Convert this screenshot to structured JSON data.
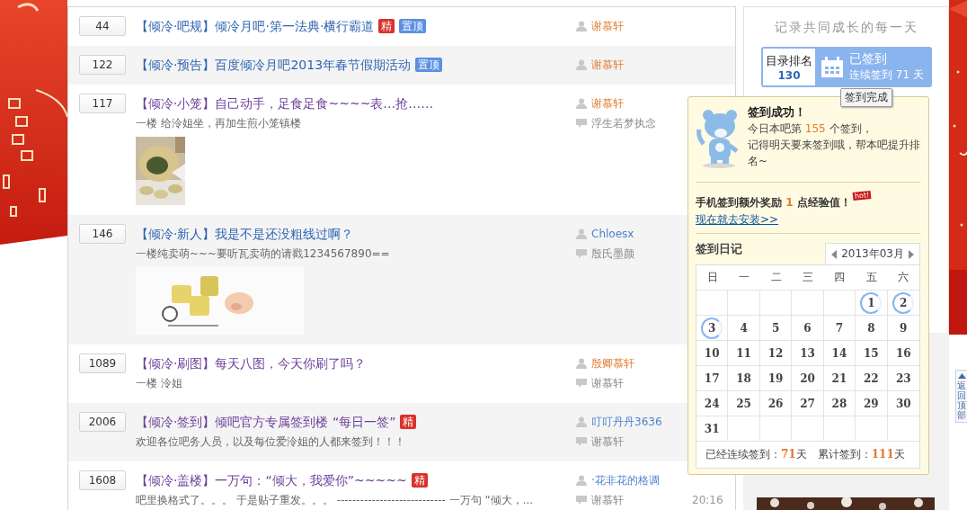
{
  "threads": [
    {
      "reply_count": "44",
      "title": "【倾冷·吧规】倾冷月吧·第一法典·横行霸道",
      "visited": false,
      "badges": [
        {
          "kind": "best",
          "text": "精"
        },
        {
          "kind": "top",
          "text": "置顶"
        }
      ],
      "author": {
        "name": "谢慕轩",
        "color": "#e07a30"
      }
    },
    {
      "reply_count": "122",
      "title": "【倾冷·预告】百度倾冷月吧2013年春节假期活动",
      "visited": false,
      "badges": [
        {
          "kind": "top",
          "text": "置顶"
        }
      ],
      "author": {
        "name": "谢慕轩",
        "color": "#e07a30"
      }
    },
    {
      "reply_count": "117",
      "title": "【倾冷·小笼】自己动手，足食足食~~~~表…抢……",
      "visited": true,
      "author": {
        "name": "谢慕轩",
        "color": "#e07a30"
      },
      "summary": "一楼  给泠姐坐，再加生煎小笼镇楼",
      "last_reply": "浮生若梦执念"
    },
    {
      "reply_count": "146",
      "title": "【倾冷·新人】我是不是还没粗线过啊？",
      "visited": false,
      "author": {
        "name": "Chloesx",
        "color": "#4f7fcf"
      },
      "summary": "一楼纯卖萌~~~要听瓦卖萌的请戳1234567890==",
      "last_reply": "殷氏墨颜"
    },
    {
      "reply_count": "1089",
      "title": "【倾冷·刷图】每天八图，今天你刷了吗？",
      "visited": true,
      "author": {
        "name": "殷卿慕轩",
        "color": "#e07a30"
      },
      "summary": "一楼  泠姐",
      "last_reply": "谢慕轩"
    },
    {
      "reply_count": "2006",
      "title": "【倾冷·签到】倾吧官方专属签到楼 “每日一签”",
      "visited": true,
      "badges": [
        {
          "kind": "best",
          "text": "精"
        }
      ],
      "author": {
        "name": "叮叮丹丹3636",
        "color": "#4f7fcf"
      },
      "summary": "欢迎各位吧务人员，以及每位爱泠姐的人都来签到！！！",
      "last_reply": "谢慕轩"
    },
    {
      "reply_count": "1608",
      "title": "【倾冷·盖楼】一万句：“倾大，我爱你”~~~~~",
      "visited": true,
      "badges": [
        {
          "kind": "best",
          "text": "精"
        }
      ],
      "author": {
        "name": "·花非花的格调",
        "color": "#4f7fcf"
      },
      "summary": "吧里换格式了。。。  于是贴子重发。。。  ---------------------------- 一万句 “倾大，...",
      "last_reply": "谢慕轩",
      "time": "20:16"
    }
  ],
  "sidebar": {
    "slogan": "记录共同成长的每一天",
    "rank_label": "目录排名",
    "rank": "130",
    "signed": true,
    "sign_status": "已签到",
    "streak": "连续签到 71 天",
    "tooltip": "签到完成"
  },
  "popup": {
    "title": "签到成功！",
    "message": [
      "今日本吧第 **155** 个签到，",
      "记得明天要来签到哦，帮本吧提升排名~"
    ],
    "reward": "手机签到额外奖励 **1** 点经验值！",
    "hot_badge": "hot!",
    "link": "现在就去安装>>",
    "diary_title": "签到日记",
    "month": "2013年03月",
    "weekdays": [
      "日",
      "一",
      "二",
      "三",
      "四",
      "五",
      "六"
    ],
    "weeks": [
      [
        {
          "kind": "blank"
        },
        {
          "kind": "blank"
        },
        {
          "kind": "blank"
        },
        {
          "kind": "blank"
        },
        {
          "kind": "blank"
        },
        {
          "kind": "day",
          "day": "1",
          "signed": true
        },
        {
          "kind": "day",
          "day": "2",
          "signed": true
        }
      ],
      [
        {
          "kind": "day",
          "day": "3",
          "signed": true
        },
        {
          "kind": "day",
          "day": "4",
          "signed": false
        },
        {
          "kind": "day",
          "day": "5",
          "signed": false
        },
        {
          "kind": "day",
          "day": "6",
          "signed": false
        },
        {
          "kind": "day",
          "day": "7",
          "signed": false
        },
        {
          "kind": "day",
          "day": "8",
          "signed": false
        },
        {
          "kind": "day",
          "day": "9",
          "signed": false
        }
      ],
      [
        {
          "kind": "day",
          "day": "10",
          "signed": false
        },
        {
          "kind": "day",
          "day": "11",
          "signed": false
        },
        {
          "kind": "day",
          "day": "12",
          "signed": false
        },
        {
          "kind": "day",
          "day": "13",
          "signed": false
        },
        {
          "kind": "day",
          "day": "14",
          "signed": false
        },
        {
          "kind": "day",
          "day": "15",
          "signed": false
        },
        {
          "kind": "day",
          "day": "16",
          "signed": false
        }
      ],
      [
        {
          "kind": "day",
          "day": "17",
          "signed": false
        },
        {
          "kind": "day",
          "day": "18",
          "signed": false
        },
        {
          "kind": "day",
          "day": "19",
          "signed": false
        },
        {
          "kind": "day",
          "day": "20",
          "signed": false
        },
        {
          "kind": "day",
          "day": "21",
          "signed": false
        },
        {
          "kind": "day",
          "day": "22",
          "signed": false
        },
        {
          "kind": "day",
          "day": "23",
          "signed": false
        }
      ],
      [
        {
          "kind": "day",
          "day": "24",
          "signed": false
        },
        {
          "kind": "day",
          "day": "25",
          "signed": false
        },
        {
          "kind": "day",
          "day": "26",
          "signed": false
        },
        {
          "kind": "day",
          "day": "27",
          "signed": false
        },
        {
          "kind": "day",
          "day": "28",
          "signed": false
        },
        {
          "kind": "day",
          "day": "29",
          "signed": false
        },
        {
          "kind": "day",
          "day": "30",
          "signed": false
        }
      ],
      [
        {
          "kind": "day",
          "day": "31",
          "signed": false
        },
        {
          "kind": "blank"
        },
        {
          "kind": "blank"
        },
        {
          "kind": "blank"
        },
        {
          "kind": "blank"
        },
        {
          "kind": "blank"
        },
        {
          "kind": "blank"
        }
      ]
    ],
    "streak_total": "已经连续签到：**71**天",
    "sign_total": "累计签到：**111**天"
  },
  "back_to_top": "返回顶部"
}
